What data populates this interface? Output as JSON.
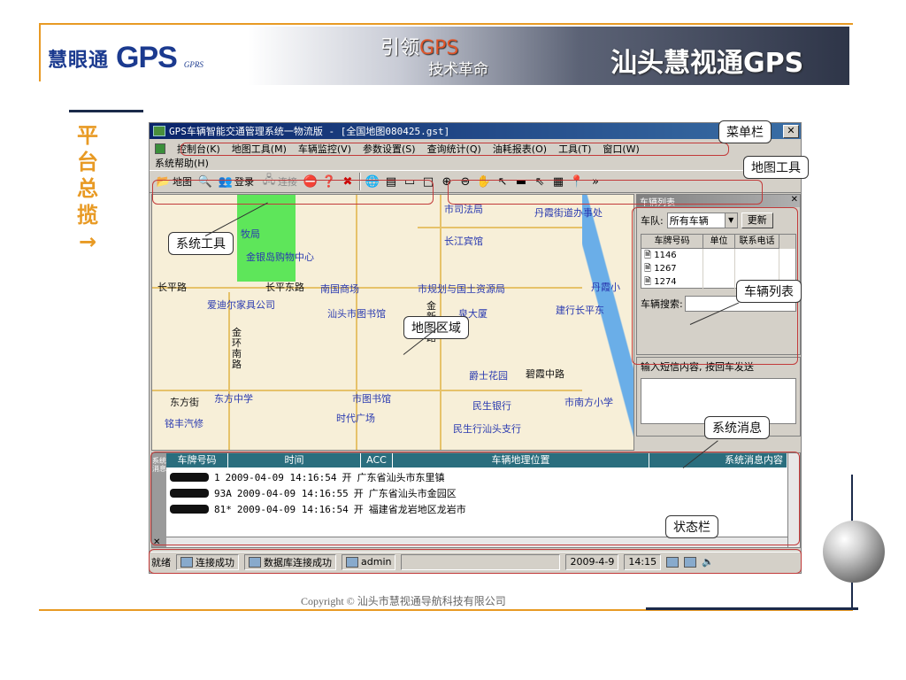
{
  "slide": {
    "brand_cn": "慧眼通",
    "brand_gps": "GPS",
    "brand_sub": "GPRS",
    "slogan_line1_a": "引领",
    "slogan_line1_b": "GPS",
    "slogan_line2": "技术革命",
    "banner_title": "汕头慧视通GPS",
    "side_title": "平台总揽→",
    "copyright": "Copyright © 汕头市慧视通导航科技有限公司"
  },
  "window": {
    "title": "GPS车辆智能交通管理系统一物流版 - [全国地图080425.gst]",
    "close": "✕",
    "menu_row1": [
      "控制台(K)",
      "地图工具(M)",
      "车辆监控(V)",
      "参数设置(S)",
      "查询统计(Q)",
      "油耗报表(O)",
      "工具(T)",
      "窗口(W)"
    ],
    "menu_row2": [
      "系统帮助(H)"
    ],
    "toolbar": {
      "map": "地图",
      "login": "登录",
      "connect": "连接"
    }
  },
  "map": {
    "labels": [
      "市司法局",
      "丹霞街道办事处",
      "牧局",
      "长江宾馆",
      "金银岛购物中心",
      "长平路",
      "长平东路",
      "南国商场",
      "市规划与国土资源局",
      "丹霞小",
      "爱迪尔家具公司",
      "汕头市图书馆",
      "泉大厦",
      "建行长平东",
      "金环南路",
      "爵士花园",
      "碧霞中路",
      "东方街",
      "东方中学",
      "市图书馆",
      "民生银行",
      "市南方小学",
      "铭丰汽修",
      "时代广场",
      "民生行汕头支行",
      "金新门路"
    ]
  },
  "vehicle_panel": {
    "title": "车辆列表",
    "team_label": "车队:",
    "team_value": "所有车辆",
    "refresh": "更新",
    "columns": [
      "车牌号码",
      "单位",
      "联系电话"
    ],
    "rows": [
      "1146",
      "1267",
      "1274"
    ],
    "search_label": "车辆搜索:"
  },
  "sms_panel": {
    "prompt": "输入短信内容,  按回车发送"
  },
  "log": {
    "side": "系统消息",
    "columns": [
      "车牌号码",
      "时间",
      "ACC",
      "车辆地理位置",
      "系统消息内容"
    ],
    "rows": [
      {
        "plate_suffix": "1",
        "time": "2009-04-09 14:16:54",
        "acc": "开",
        "location": "广东省汕头市东里镇"
      },
      {
        "plate_suffix": "93A",
        "time": "2009-04-09 14:16:55",
        "acc": "开",
        "location": "广东省汕头市金园区"
      },
      {
        "plate_suffix": "81*",
        "time": "2009-04-09 14:16:54",
        "acc": "开",
        "location": "福建省龙岩地区龙岩市"
      }
    ]
  },
  "statusbar": {
    "ready": "就绪",
    "conn": "连接成功",
    "db": "数据库连接成功",
    "user": "admin",
    "date": "2009-4-9",
    "time": "14:15"
  },
  "callouts": {
    "menubar": "菜单栏",
    "maptools": "地图工具",
    "systools": "系统工具",
    "vehlist": "车辆列表",
    "maparea": "地图区域",
    "sysmsg": "系统消息",
    "statusbar": "状态栏"
  },
  "colors": {
    "accent_orange": "#e89a24",
    "brand_blue": "#1b3a8f",
    "titlebar": "#0a246a",
    "map_bg": "#f7efd8",
    "park_green": "#5ee65a",
    "log_header": "#2a6e7e",
    "callout_border": "#c23a3a"
  }
}
